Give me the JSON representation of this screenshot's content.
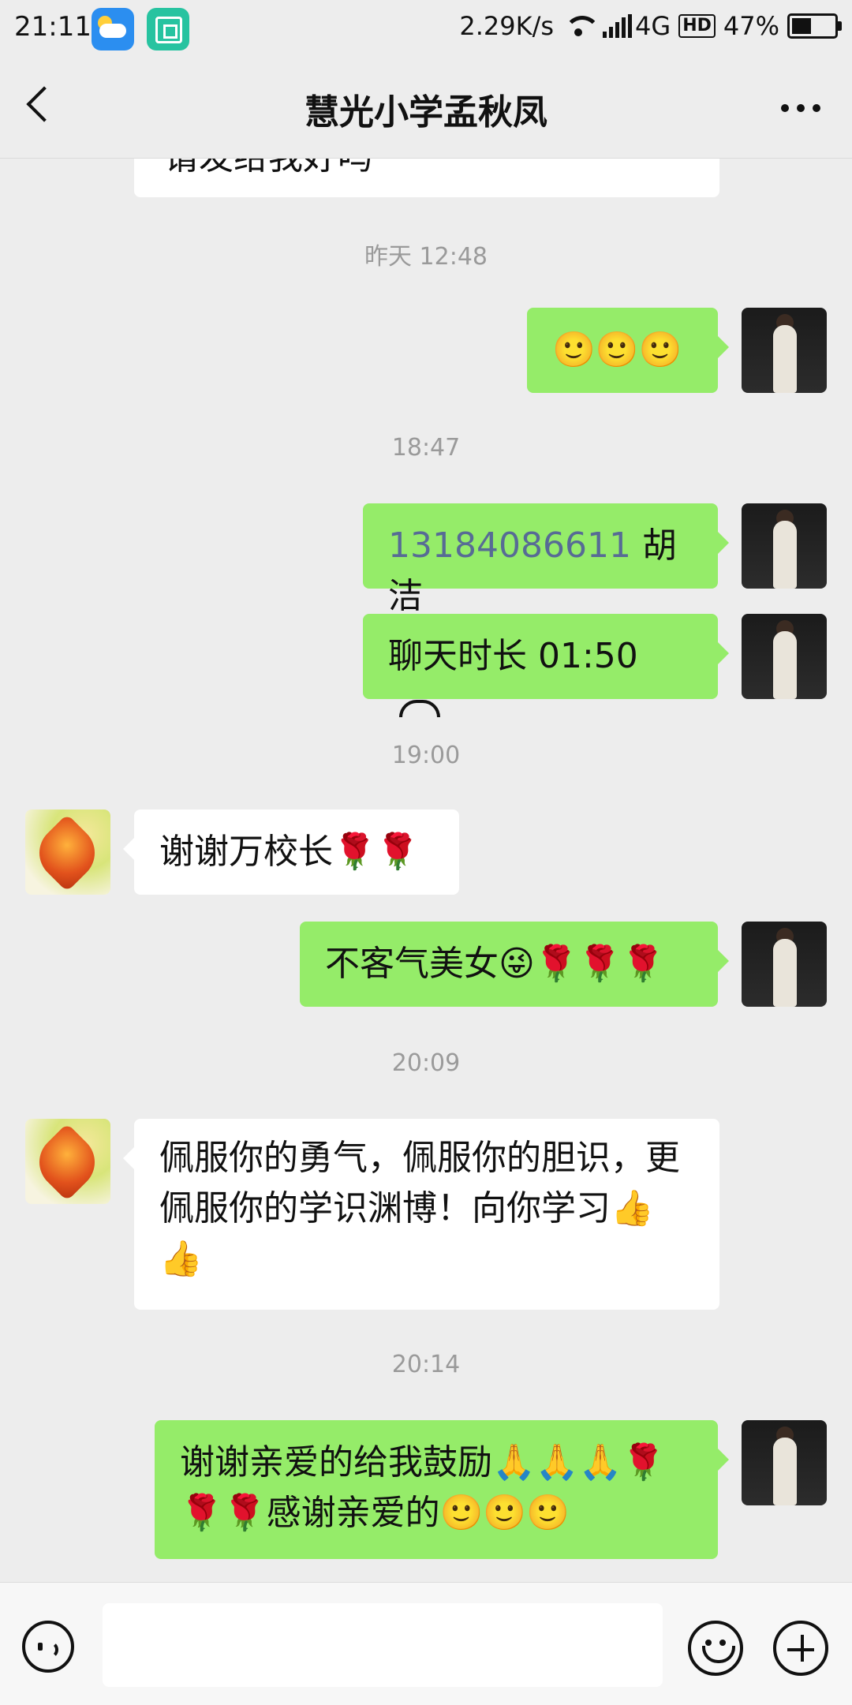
{
  "status_bar": {
    "time": "21:11",
    "net_speed": "2.29K/s",
    "network": "4G",
    "hd": "HD",
    "battery": "47%",
    "battery_level": 0.47
  },
  "header": {
    "title": "慧光小学孟秋凤"
  },
  "chat": {
    "partial_top_text": "请发给我好吗",
    "timestamps": [
      "昨天 12:48",
      "18:47",
      "19:00",
      "20:09",
      "20:14"
    ],
    "messages": [
      {
        "from": "me",
        "text": "🙂🙂🙂"
      },
      {
        "from": "me",
        "phone": "13184086611",
        "text": "胡洁"
      },
      {
        "from": "me",
        "text": "聊天时长 01:50"
      },
      {
        "from": "them",
        "text": "谢谢万校长🌹🌹"
      },
      {
        "from": "me",
        "text": "不客气美女😜🌹🌹🌹"
      },
      {
        "from": "them",
        "text": "佩服你的勇气，佩服你的胆识，更佩服你的学识渊博！向你学习👍👍"
      },
      {
        "from": "me",
        "text": "谢谢亲爱的给我鼓励🙏🙏🙏🌹🌹🌹感谢亲爱的🙂🙂🙂"
      }
    ]
  },
  "input_bar": {
    "value": ""
  },
  "icons": {
    "back": "back-arrow-icon",
    "more": "more-dots-icon",
    "voice": "voice-icon",
    "emoji": "emoji-icon",
    "plus": "plus-icon"
  },
  "colors": {
    "outgoing_bubble": "#95ec69",
    "incoming_bubble": "#ffffff",
    "background": "#ededed",
    "link": "#576b95"
  }
}
